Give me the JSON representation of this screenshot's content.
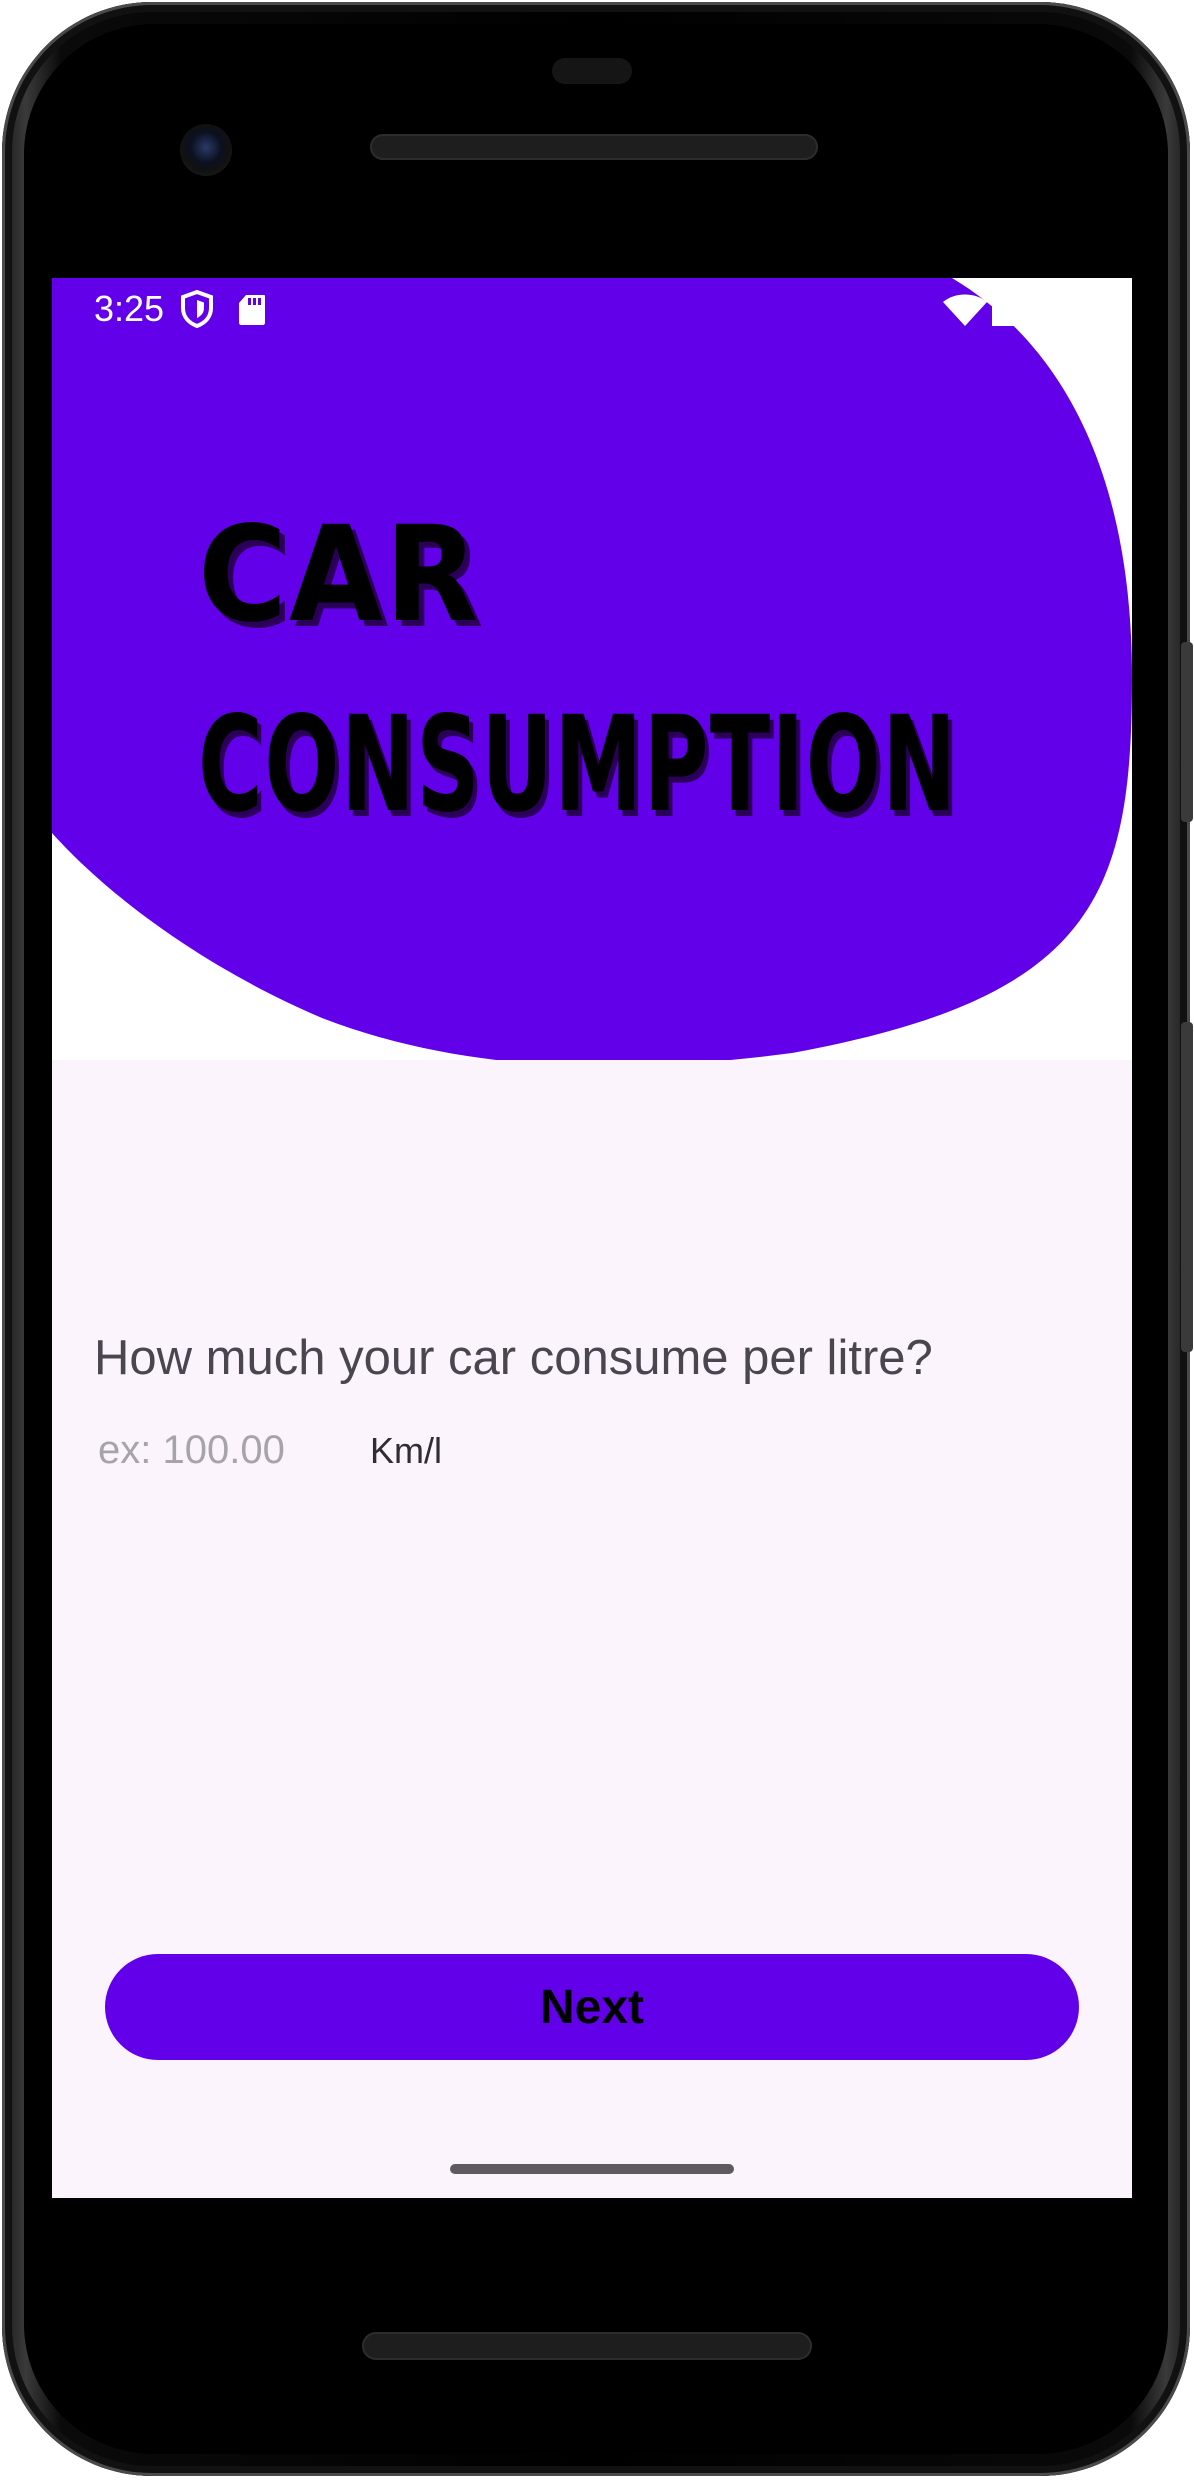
{
  "status_bar": {
    "time": "3:25",
    "icons": [
      "shield-icon",
      "sd-card-icon",
      "wifi-icon",
      "battery-icon"
    ]
  },
  "header": {
    "title_line_1": "CAR",
    "title_line_2": "CONSUMPTION"
  },
  "form": {
    "question": "How much your car consume per litre?",
    "input_placeholder": "ex: 100.00",
    "input_value": "",
    "unit": "Km/l"
  },
  "actions": {
    "next_label": "Next"
  },
  "colors": {
    "accent": "#6200ea",
    "background": "#fcf4fc",
    "header_background": "#ffffff",
    "title_text": "#000000"
  }
}
